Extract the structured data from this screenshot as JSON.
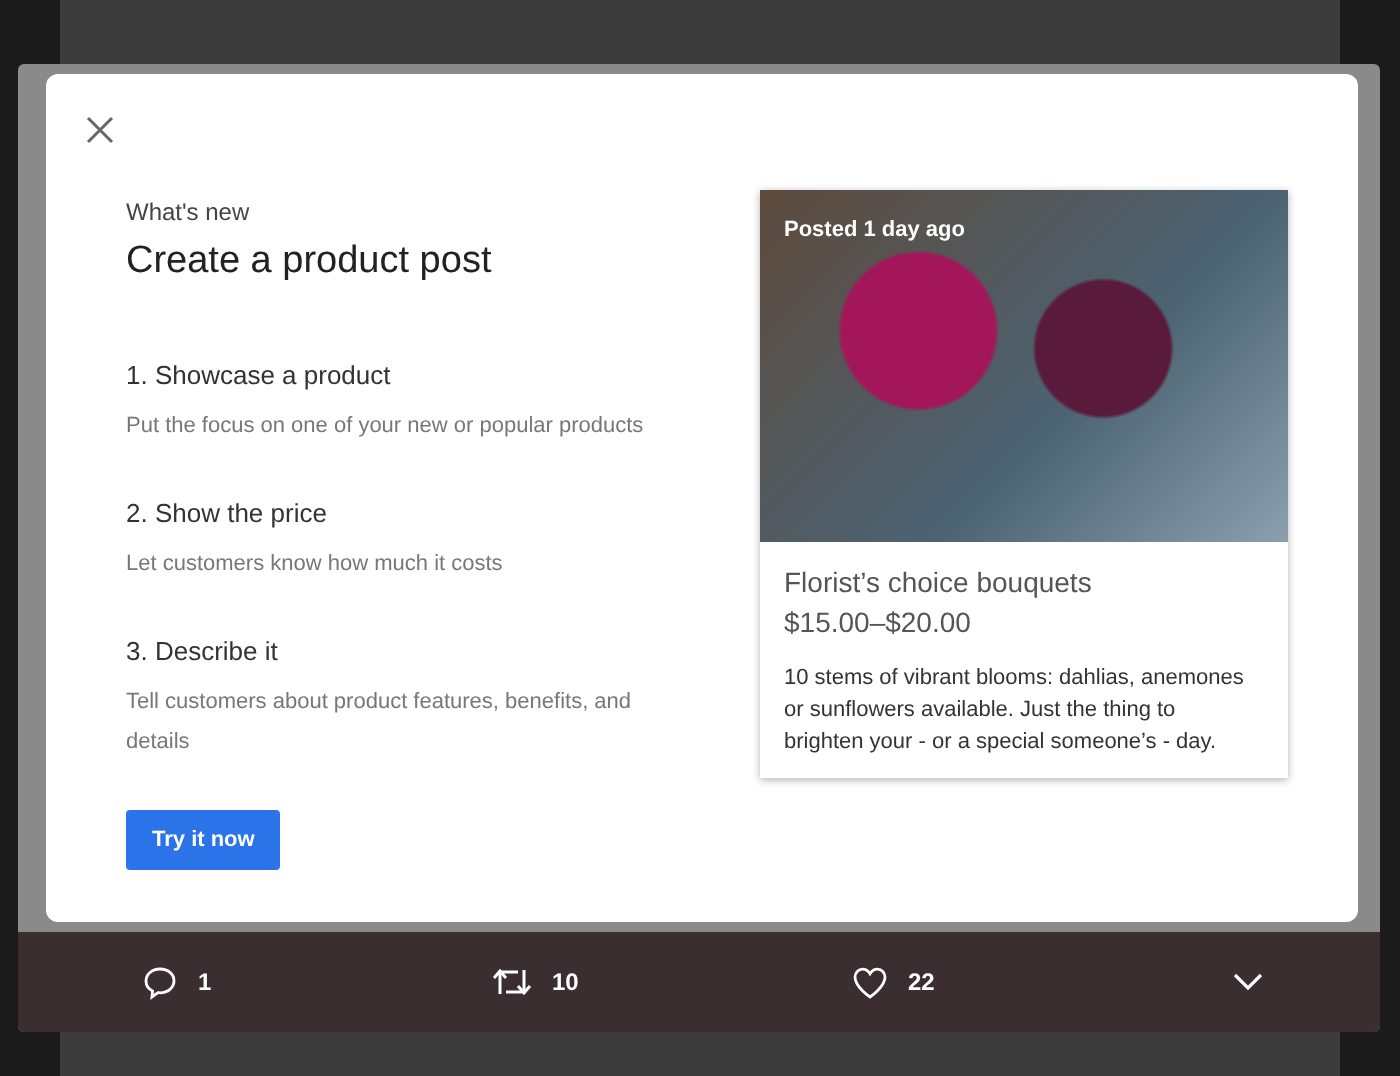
{
  "dialog": {
    "eyebrow": "What's new",
    "title": "Create a product post",
    "steps": [
      {
        "title": "1. Showcase a product",
        "description": "Put the focus on one of your new or popular products"
      },
      {
        "title": "2. Show the price",
        "description": "Let customers know how much it costs"
      },
      {
        "title": "3. Describe it",
        "description": "Tell customers about product features, benefits, and details"
      }
    ],
    "button": "Try it now",
    "card": {
      "badge": "Posted 1 day ago",
      "title": "Florist’s choice bouquets",
      "price": "$15.00–$20.00",
      "description": "10 stems of vibrant blooms: dahlias, anemones or sunflowers available. Just the thing to brighten your - or a special someone’s - day."
    }
  },
  "actions": [
    {
      "kind": "reply",
      "count": "1"
    },
    {
      "kind": "retweet",
      "count": "10"
    },
    {
      "kind": "like",
      "count": "22"
    },
    {
      "kind": "more"
    }
  ]
}
